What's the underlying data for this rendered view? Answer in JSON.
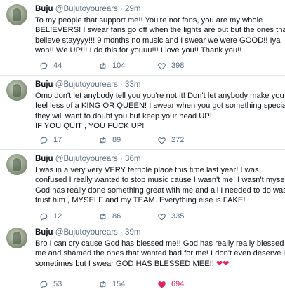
{
  "tweets": [
    {
      "name": "Buju",
      "handle": "@Bujutoyourears",
      "time": "29m",
      "lines": [
        "To my people that support me!! You're not fans, you are my whole",
        "BELIEVERS! I swear fans go off when the lights are out but the ones that",
        "believe stayyyy!!! 9 months no music and I swear we were GOOD!! Iya",
        "won!! We UP!!! I do this for youuu!!! I love you!! Thank you!!"
      ],
      "replies": "44",
      "retweets": "104",
      "likes": "398",
      "liked": false
    },
    {
      "name": "Buju",
      "handle": "@Bujutoyourears",
      "time": "33m",
      "lines": [
        "Omo don't let anybody tell you you're not it! Don't let anybody make you",
        "feel less of a KING OR QUEEN! I swear when you got something special,",
        "they will want to doubt you but keep your head UP!",
        "IF YOU QUIT , YOU FUCK UP!"
      ],
      "replies": "17",
      "retweets": "89",
      "likes": "272",
      "liked": false
    },
    {
      "name": "Buju",
      "handle": "@Bujutoyourears",
      "time": "36m",
      "lines": [
        "I was in a very very VERY terrible place this time last year! I was",
        "confused I really wanted to stop music cause I wasn't me! I wasn't myself!",
        "God has really done something great with me and all I needed to do was",
        "trust him , MYSELF and my TEAM. Everything else is FAKE!"
      ],
      "replies": "12",
      "retweets": "86",
      "likes": "335",
      "liked": false
    },
    {
      "name": "Buju",
      "handle": "@Bujutoyourears",
      "time": "39m",
      "lines": [
        "Bro I can cry cause God has blessed me!! God has really really blessed",
        "me and shamed the ones that wanted bad for me! I don't even deserve it",
        "sometimes but I swear GOD HAS BLESSED MEE!!"
      ],
      "emoji": "❤❤",
      "replies": "53",
      "retweets": "154",
      "likes": "694",
      "liked": true
    }
  ],
  "dot": "·",
  "colors": {
    "text": "#0f1419",
    "muted": "#5b7083",
    "like": "#e0245e",
    "divider": "#e1e8ed"
  },
  "icons": {
    "reply": "reply-icon",
    "retweet": "retweet-icon",
    "like": "heart-icon"
  }
}
